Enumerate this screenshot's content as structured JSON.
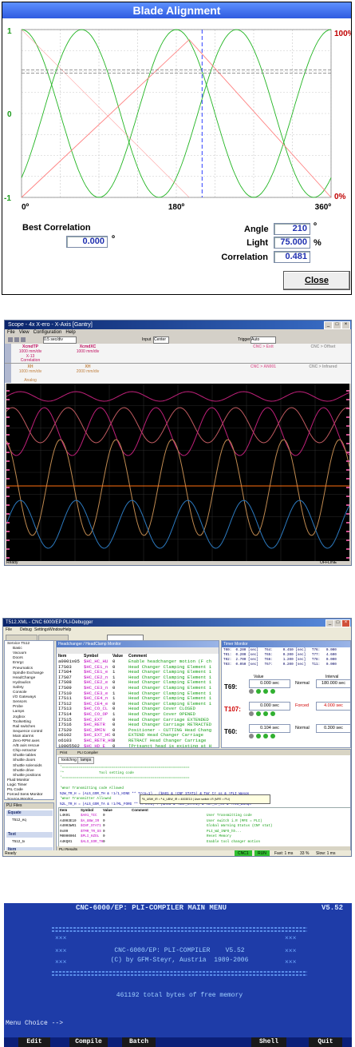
{
  "blade_alignment": {
    "title": "Blade Alignment",
    "left_axis_top": "1",
    "left_axis_mid": "0",
    "left_axis_bottom": "-1",
    "right_axis_top": "100%",
    "right_axis_bottom": "0%",
    "x_ticks": [
      "0º",
      "180º",
      "360º"
    ],
    "best_correlation_label": "Best Correlation",
    "best_correlation_value": "0.000",
    "best_correlation_unit": "º",
    "angle_label": "Angle",
    "angle_value": "210",
    "angle_unit": "º",
    "light_label": "Light",
    "light_value": "75.000",
    "light_unit": "%",
    "correlation_label": "Correlation",
    "correlation_value": "0.481",
    "close_label": "Close",
    "colors": {
      "sine": "#22b522",
      "light": "#ff8080",
      "cursor": "#3040ff"
    }
  },
  "scope": {
    "title": "Scope - 4x X-ero - X-Axis [Gantry]",
    "menu": [
      "File",
      "View",
      "Configuration",
      "Help"
    ],
    "toolbar": {
      "time_div": "0.5 sec/div",
      "input": "Input",
      "center": "Center",
      "trigger": "Trigger",
      "trigger_value": "Auto",
      "status_right": "OFFLINE",
      "status_left": "Ready"
    },
    "channels_row1": [
      {
        "name": "XcmdTP",
        "scale": "1000 mm/div",
        "sub": "X-13",
        "note": "Correlation",
        "color": "#c01060"
      },
      {
        "name": "XcmdXC",
        "scale": "1000 mm/div",
        "sub": "",
        "note": "",
        "color": "#c01060"
      },
      {
        "name": "CNC > Exit",
        "scale": "",
        "sub": "",
        "note": "",
        "color": "#e070a0"
      },
      {
        "name": "CNC > Offset",
        "scale": "",
        "sub": "",
        "note": "",
        "color": "#999999"
      }
    ],
    "channels_row2": [
      {
        "name": "XH",
        "scale": "1000 mm/div",
        "sub": "",
        "note": "Analog",
        "color": "#c08040"
      },
      {
        "name": "XH",
        "scale": "2000 mm/div",
        "sub": "",
        "note": "",
        "color": "#c08040"
      },
      {
        "name": "CNC > AN001",
        "scale": "",
        "sub": "",
        "note": "",
        "color": "#e070a0"
      },
      {
        "name": "CNC > Infrared",
        "scale": "",
        "sub": "",
        "note": "",
        "color": "#999999"
      }
    ],
    "colors": {
      "wave1": "#c0207a",
      "wave2": "#c05a60",
      "wave3": "#c08a50",
      "wave4": "#2c7ac0",
      "mid": "#ff7010"
    }
  },
  "pli_debugger": {
    "title": "T512.XML - CNC 6000/EP PLI-Debugger",
    "menu": [
      "File",
      "Debug",
      "Settings",
      "Window",
      "Help"
    ],
    "tree_items": [
      "Service T512",
      "Basic",
      "Vacuum",
      "Doors",
      "Emrgc",
      "Pneumatics",
      "Spindle Exchange",
      "HeadChange",
      "Hydraulics",
      "Safety",
      "Console",
      "I/O Gateways",
      "Sensors",
      "Probe",
      "Lamps",
      "Jogbox",
      "Toolsetting",
      "Rail switches",
      "Sequence control",
      "Main alarms",
      "Zero-RPM axes",
      "A/B axis rescue",
      "Chip extractor",
      "Shuttle tables",
      "Shuttle doors",
      "Shuttle solenoids",
      "Shuttle drive",
      "Shuttle positions",
      "Fluid Monitor",
      "Logic Timer",
      "PIL Code",
      "Forced Sens Monitor",
      "Source Monitor"
    ],
    "hcon_title": "Headchanger / HeadClamp Monitor",
    "hcon_headers": [
      "Item",
      "Symbol",
      "Value",
      "Comment"
    ],
    "hcon_rows": [
      [
        "a0001x05",
        "$HC_HC_HU",
        "0",
        "Enable headchanger motion (F ch"
      ],
      [
        "I7S03",
        "$HC_CE1_n",
        "0",
        "Head Changer Clamping Element 1"
      ],
      [
        "I7S04",
        "$HC_CE1_e",
        "1",
        "Head Changer Clamping Element 1"
      ],
      [
        "I7S07",
        "$HC_CE2_n",
        "1",
        "Head Changer Clamping Element 1"
      ],
      [
        "I7S08",
        "$HC_CE2_e",
        "0",
        "Head Changer Clamping Element 1"
      ],
      [
        "I7S09",
        "$HC_CE3_n",
        "0",
        "Head Changer Clamping Element 1"
      ],
      [
        "I7S10",
        "$HC_CE3_e",
        "1",
        "Head Changer Clamping Element 1"
      ],
      [
        "I7S11",
        "$HC_CE4_n",
        "1",
        "Head Changer Clamping Element 1"
      ],
      [
        "I7S12",
        "$HC_CE4_e",
        "0",
        "Head Changer Clamping Element 1"
      ],
      [
        "I7S13",
        "$HC_CO_CL",
        "0",
        "Head Changer Cover CLOSED"
      ],
      [
        "I7S14",
        "$HC_CO_OP",
        "1",
        "Head Changer Cover OPENED"
      ],
      [
        "I7S15",
        "$HC_EXT",
        "0",
        "Head Changer Carriage EXTENDED"
      ],
      [
        "I7S16",
        "$HC_RETR",
        "0",
        "Head Changer Carriage RETRACTED"
      ],
      [
        "I7S20",
        "$HC_RMIN",
        "0",
        "Positioner - CUTTING Head Chang"
      ],
      [
        "o6102",
        "$HC_EXT_HC",
        "0",
        "EXTEND Head Changer Carriage"
      ],
      [
        "o6103",
        "$HC_RETR_HC",
        "0",
        "RETRACT Head Changer Carriage"
      ],
      [
        "10005502",
        "$HC_HD_E",
        "0",
        "[Prtsanct head is existing at H"
      ]
    ],
    "timer_title": "Timer Monitor",
    "timer_header_lines": [
      "T00:  0.200 [sec]   T64:     0.450 [sec]   T76:   0.000",
      "T01:  0.200 [sec]   T65:     0.200 [sec]   T77:   4.600",
      "T02:  2.700 [sec]   T66:     1.200 [sec]   T78:   0.000",
      "T03:  0.050 [sec]   T67:     0.200 [sec]   T11:   0.000"
    ],
    "timers": [
      {
        "name": "T69:",
        "value": "0.000 sec",
        "mode": "Normal",
        "interval": "180.000 sec",
        "color": "#000000"
      },
      {
        "name": "T107:",
        "value": "0.000 sec",
        "mode": "Forced",
        "interval": "4.000 sec",
        "color": "#d00000"
      },
      {
        "name": "T60:",
        "value": "0.104 sec",
        "mode": "Normal",
        "interval": "0.300 sec",
        "color": "#000000"
      }
    ],
    "timer_col_value": "Value",
    "timer_col_interval": "Interval",
    "files_title": "PLI Files",
    "files_groups": [
      "Equate",
      "Text",
      "Item"
    ],
    "files_items": [
      "T512_eq",
      "T512_tx",
      "mxs2pl",
      "panel",
      "mxs4en",
      "fanees",
      "ultra206",
      "mnxes",
      "toolchg",
      "probe",
      "vacuum",
      "axes",
      "relnam"
    ],
    "src_tabs": [
      "Print",
      "PLI Compiler"
    ],
    "src_file_tabs": [
      "toolchng",
      "lamps"
    ],
    "src_lines": [
      "'==============================================================",
      "'*                 Tool setting code",
      "'==============================================================",
      "",
      "'Wear Transmitting code Allowed",
      "%2W_TR_H = (ALS_GOR_TH & !1/1_HINE ** Tr<n=1) . ($A01 & !CNF_STAT1) & Tmr_tr_ss & !PLI_Wasqs",
      "'Wear Transmitter Allowed",
      "%2L_TR_H = (ALS_GOR_TA & !1/ML_FORG ** Tr<n=1) . ($A01 & !CNF_STAT1) & Tmr_tr_ss & !PLI_Wasqs"
    ],
    "tooltip": "ªA_UBW_IR = ª A_UBW_IR = 4003E10 | User switch i.R (MFE = PLI)",
    "var_headers": [
      "Item",
      "Symbol",
      "Value",
      "Comment"
    ],
    "var_rows": [
      [
        "L4K01",
        "$A01_TIC",
        "0",
        "User Transmitting code"
      ],
      [
        "A4003E10",
        "$A_UBW_IR",
        "0",
        "User switch i.R (MFE = PLI)"
      ],
      [
        "A4003W01",
        "$CNF_STAT1",
        "0",
        "Global Warning Status (CNF stat)"
      ],
      [
        "0x09",
        "$TMR_TR_SS",
        "0",
        "PLI_Wd_INFO_hh..."
      ],
      [
        "M0000004",
        "$PLI_HZOL",
        "0",
        "Reset Memory"
      ],
      [
        "A4KQ01",
        "$ALS_GOR_TH",
        "0",
        "Enable tool changer motion"
      ]
    ],
    "results_title": "PLI Results",
    "status": {
      "left": "Ready",
      "cnc": "CNC1",
      "run": "RUN",
      "fast": "Fast: 1 ms",
      "fast_pct": "33 %",
      "slow": "Slow: 1 ms"
    }
  },
  "dos": {
    "title": "CNC-6000/EP: PLI-COMPILER  MAIN MENU",
    "version": "V5.52",
    "box_line1": "CNC-6000/EP: PLI-COMPILER    V5.52",
    "box_line2": "(C) by GFM-Steyr, Austria  1989-2006",
    "memory": "461192 total bytes of free memory",
    "menu_choice": "Menu Choice -->",
    "fkeys": [
      "Edit",
      "Compile",
      "Batch",
      "Shell",
      "Quit"
    ]
  }
}
